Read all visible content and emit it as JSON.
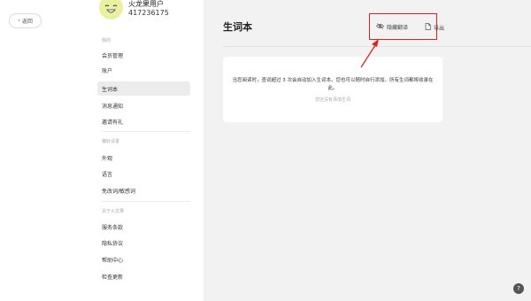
{
  "header": {
    "back_label": "返回",
    "user_name": "火龙果用户",
    "user_id": "417236175"
  },
  "sidebar": {
    "groups": [
      {
        "title": "我的",
        "items": [
          {
            "label": "会员管理"
          },
          {
            "label": "账户"
          },
          {
            "label": "生词本",
            "active": true
          },
          {
            "label": "消息通知"
          },
          {
            "label": "邀请有礼"
          }
        ]
      },
      {
        "title": "偏好设置",
        "items": [
          {
            "label": "外观"
          },
          {
            "label": "语言"
          },
          {
            "label": "免改词/敏感词"
          }
        ]
      },
      {
        "title": "关于火龙果",
        "items": [
          {
            "label": "服务条款"
          },
          {
            "label": "隐私协议"
          },
          {
            "label": "帮助中心"
          },
          {
            "label": "检查更新"
          }
        ]
      }
    ]
  },
  "main": {
    "title": "生词本",
    "hide_translation_label": "隐藏翻译",
    "export_label": "导出",
    "empty_message": "当您阅读时，查词超过 3 次会自动加入生词本。您也可以随时自行添加。所有生词都将收录在此。",
    "empty_sub": "您还没有添加生词"
  },
  "help": {
    "label": "?"
  },
  "colors": {
    "highlight": "#e02020",
    "main_bg": "#f2f2f2",
    "avatar_bg": "#e9f0a2"
  },
  "icons": {
    "back": "chevron-left-icon",
    "hide": "eye-off-icon",
    "export": "export-icon"
  }
}
